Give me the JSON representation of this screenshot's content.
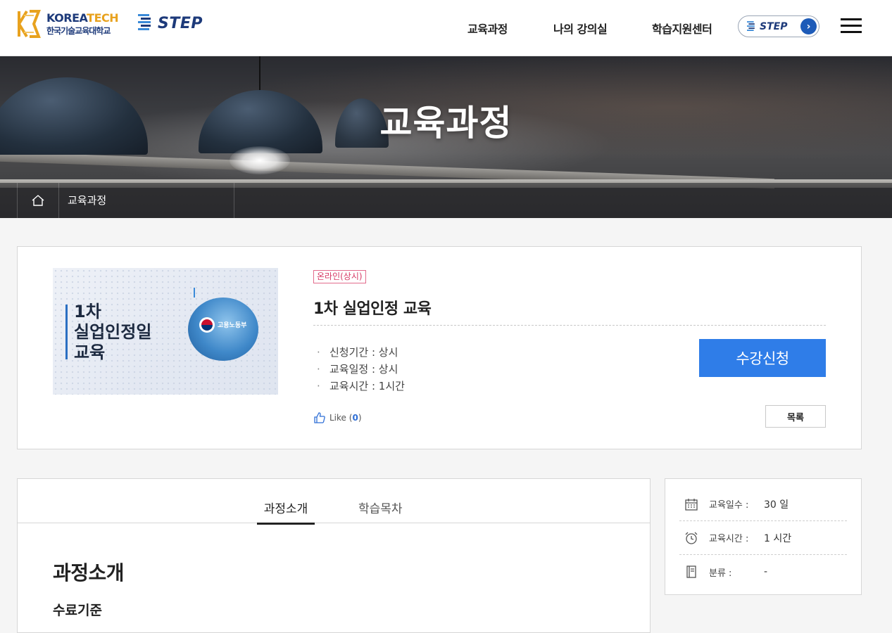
{
  "header": {
    "logo_kt_title_a": "KOREA",
    "logo_kt_title_b": "TECH",
    "logo_kt_subtitle": "한국기술교육대학교",
    "logo_step": "STEP",
    "nav": [
      "교육과정",
      "나의 강의실",
      "학습지원센터"
    ],
    "step_pill": "STEP",
    "step_pill_arrow": "›"
  },
  "banner": {
    "title": "교육과정",
    "breadcrumb": "교육과정"
  },
  "course": {
    "thumbnail_text": [
      "1차",
      "실업인정일",
      "교육"
    ],
    "thumbnail_emblem_text": "고용노동부",
    "badge": "온라인(상시)",
    "title": "1차 실업인정 교육",
    "info": [
      "신청기간 : 상시",
      "교육일정 : 상시",
      "교육시간 : 1시간"
    ],
    "apply_label": "수강신청",
    "like_label": "Like",
    "like_open": "(",
    "like_count": "0",
    "like_close": ")",
    "list_label": "목록"
  },
  "detail": {
    "tabs": [
      "과정소개",
      "학습목차"
    ],
    "active_tab": 0,
    "heading": "과정소개",
    "subheading": "수료기준"
  },
  "side_info": [
    {
      "icon": "calendar-icon",
      "label": "교육일수 :",
      "value": "30 일"
    },
    {
      "icon": "alarm-clock-icon",
      "label": "교육시간 :",
      "value": "1 시간"
    },
    {
      "icon": "book-icon",
      "label": "분류 :",
      "value": "-"
    }
  ],
  "colors": {
    "accent": "#2f7de8",
    "brand_navy": "#1d3a7a",
    "brand_orange": "#e8a21e",
    "badge": "#d63b66"
  }
}
